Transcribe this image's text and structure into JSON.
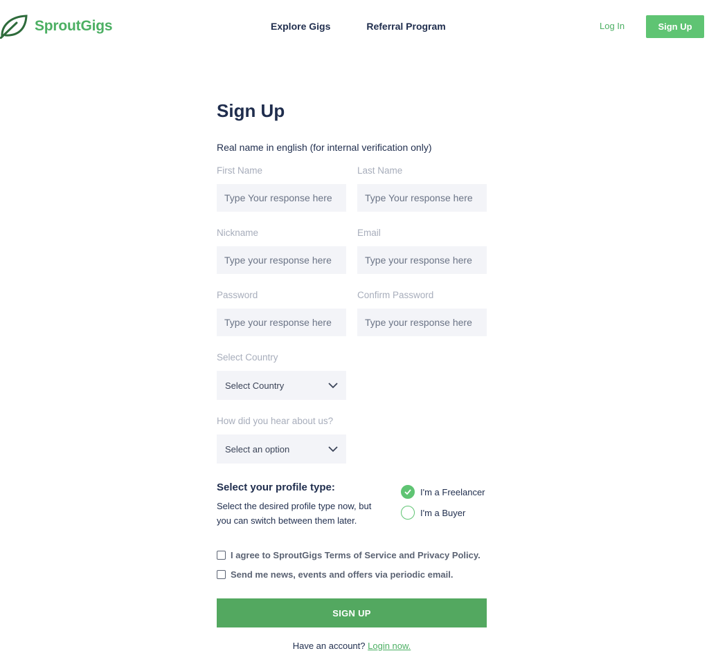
{
  "brand": {
    "name": "SproutGigs",
    "accent": "#4caf63"
  },
  "nav": {
    "items": [
      "Explore Gigs",
      "Referral Program"
    ],
    "login_label": "Log In",
    "signup_label": "Sign Up"
  },
  "form": {
    "title": "Sign Up",
    "realname_note": "Real name in english (for internal verification only)",
    "first_name": {
      "label": "First Name",
      "placeholder": "Type Your response here"
    },
    "last_name": {
      "label": "Last Name",
      "placeholder": "Type Your response here"
    },
    "nickname": {
      "label": "Nickname",
      "placeholder": "Type your response here"
    },
    "email": {
      "label": "Email",
      "placeholder": "Type your response here"
    },
    "password": {
      "label": "Password",
      "placeholder": "Type your response here"
    },
    "confirm_password": {
      "label": "Confirm Password",
      "placeholder": "Type your response here"
    },
    "country": {
      "label": "Select Country",
      "value": "Select Country"
    },
    "referral": {
      "label": "How did you hear about us?",
      "value": "Select an option"
    },
    "profile": {
      "title": "Select your profile type:",
      "description": "Select the desired profile type now, but you can switch between them later.",
      "options": [
        {
          "label": "I'm a Freelancer",
          "checked": true
        },
        {
          "label": "I'm a Buyer",
          "checked": false
        }
      ]
    },
    "agree_terms": "I agree to SproutGigs Terms of Service and Privacy Policy.",
    "newsletter": "Send me news, events and offers via periodic email.",
    "submit_label": "SIGN UP",
    "have_account": "Have an account?",
    "login_now": "Login now."
  }
}
